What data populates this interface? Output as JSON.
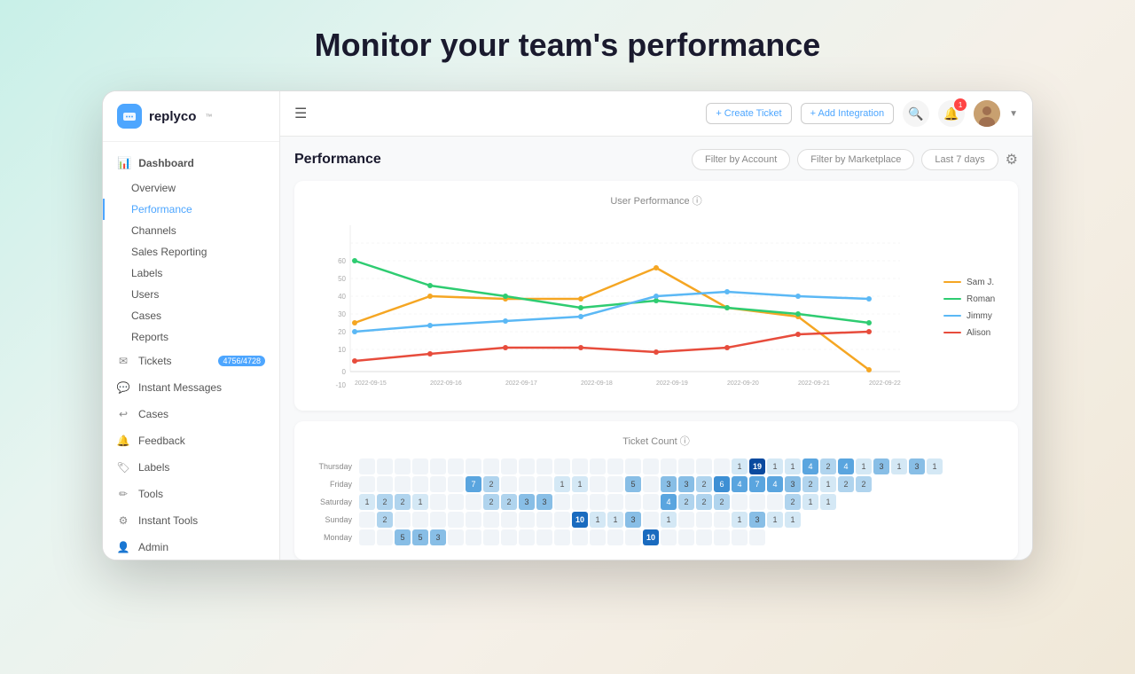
{
  "headline": "Monitor your team's performance",
  "topbar": {
    "create_ticket": "+ Create Ticket",
    "add_integration": "+ Add Integration",
    "notifications_count": "1"
  },
  "sidebar": {
    "logo_text": "replyco",
    "dashboard_label": "Dashboard",
    "sub_items": [
      {
        "label": "Overview",
        "active": false
      },
      {
        "label": "Performance",
        "active": true
      },
      {
        "label": "Channels",
        "active": false
      },
      {
        "label": "Sales Reporting",
        "active": false
      },
      {
        "label": "Labels",
        "active": false
      },
      {
        "label": "Users",
        "active": false
      },
      {
        "label": "Cases",
        "active": false
      },
      {
        "label": "Reports",
        "active": false
      }
    ],
    "main_items": [
      {
        "label": "Tickets",
        "badge": "4756/4728",
        "icon": "ticket"
      },
      {
        "label": "Instant Messages",
        "badge": null,
        "icon": "message"
      },
      {
        "label": "Cases",
        "badge": null,
        "icon": "cases"
      },
      {
        "label": "Feedback",
        "badge": null,
        "icon": "feedback"
      },
      {
        "label": "Labels",
        "badge": null,
        "icon": "labels"
      },
      {
        "label": "Tools",
        "badge": null,
        "icon": "tools"
      },
      {
        "label": "Instant Tools",
        "badge": null,
        "icon": "instant-tools"
      },
      {
        "label": "Admin",
        "badge": null,
        "icon": "admin"
      }
    ]
  },
  "performance": {
    "page_title": "Performance",
    "filter_account": "Filter by Account",
    "filter_marketplace": "Filter by Marketplace",
    "filter_time": "Last 7 days",
    "chart_title": "User Performance ⓘ",
    "legend": [
      {
        "name": "Sam J.",
        "color": "#f5a623"
      },
      {
        "name": "Roman",
        "color": "#2ecc71"
      },
      {
        "name": "Jimmy",
        "color": "#5bb8f5"
      },
      {
        "name": "Alison",
        "color": "#e74c3c"
      }
    ],
    "x_labels": [
      "2022-09-15",
      "2022-09-16",
      "2022-09-17",
      "2022-09-18",
      "2022-09-19",
      "2022-09-20",
      "2022-09-21",
      "2022-09-22"
    ],
    "y_labels": [
      "-10",
      "0",
      "10",
      "20",
      "30",
      "40",
      "50",
      "60"
    ],
    "ticket_count_title": "Ticket Count ⓘ",
    "days": [
      "Thursday",
      "Friday",
      "Saturday",
      "Sunday",
      "Monday"
    ],
    "heatmap": {
      "thursday": [
        0,
        0,
        0,
        0,
        0,
        0,
        0,
        0,
        0,
        0,
        0,
        0,
        0,
        0,
        0,
        0,
        0,
        0,
        0,
        0,
        0,
        1,
        19,
        1,
        1,
        4,
        2,
        4,
        1,
        3,
        1,
        3,
        1
      ],
      "friday": [
        0,
        0,
        0,
        0,
        0,
        0,
        7,
        2,
        0,
        0,
        0,
        1,
        1,
        0,
        0,
        5,
        0,
        3,
        3,
        2,
        6,
        4,
        7,
        4,
        3,
        2,
        1,
        2,
        2
      ],
      "saturday": [
        1,
        2,
        2,
        1,
        0,
        0,
        0,
        2,
        2,
        3,
        3,
        0,
        0,
        0,
        0,
        0,
        0,
        4,
        2,
        2,
        2,
        0,
        0,
        0,
        2,
        1,
        1
      ],
      "sunday": [
        0,
        2,
        0,
        0,
        0,
        0,
        0,
        0,
        0,
        0,
        0,
        0,
        10,
        1,
        1,
        3,
        0,
        1,
        0,
        0,
        0,
        1,
        3,
        1,
        1
      ],
      "monday": [
        0,
        0,
        5,
        5,
        3,
        0,
        0,
        0,
        0,
        0,
        0,
        0,
        0,
        0,
        0,
        0,
        10,
        0,
        0,
        0,
        0,
        0,
        0
      ]
    }
  }
}
